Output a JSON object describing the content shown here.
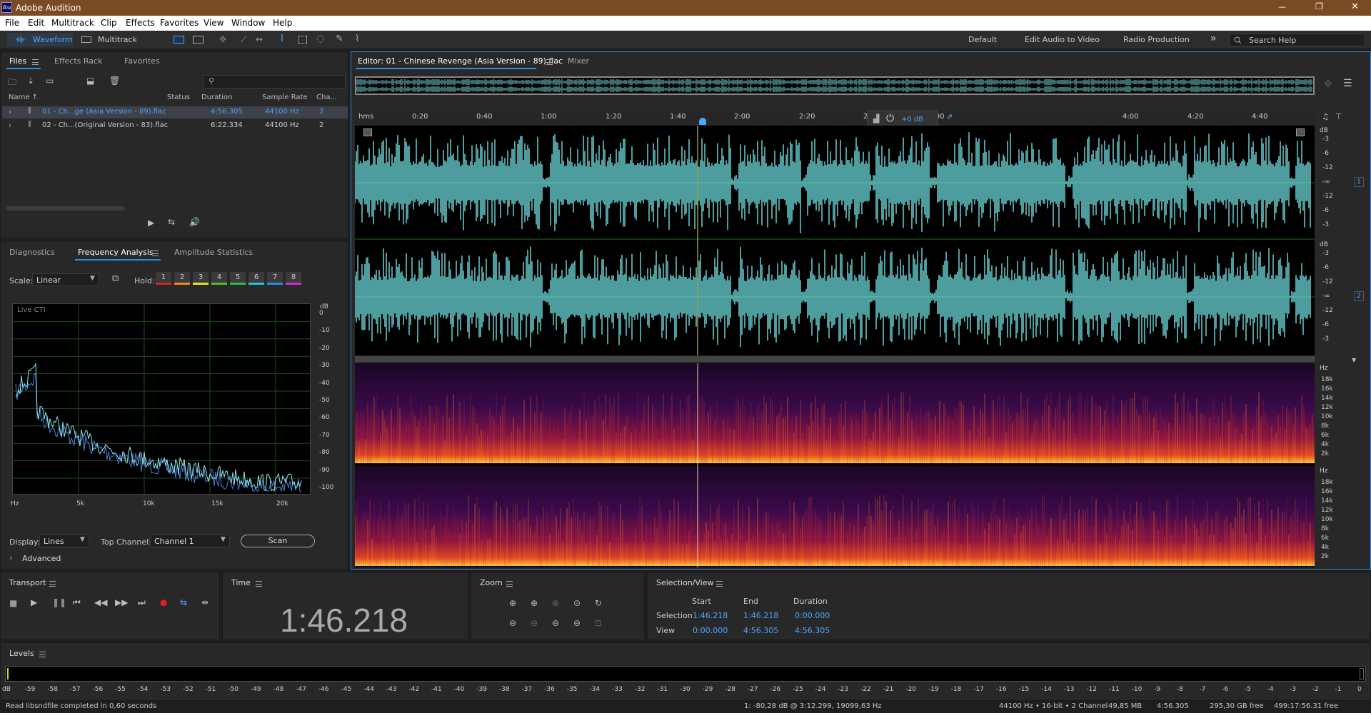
{
  "app": {
    "icon": "Au",
    "title": "Adobe Audition"
  },
  "window_controls": [
    "—",
    "❐",
    "✕"
  ],
  "menu": [
    "File",
    "Edit",
    "Multitrack",
    "Clip",
    "Effects",
    "Favorites",
    "View",
    "Window",
    "Help"
  ],
  "toolbar": {
    "waveform_label": "Waveform",
    "multitrack_label": "Multitrack",
    "workspaces": [
      "Default",
      "Edit Audio to Video",
      "Radio Production"
    ],
    "more": "»",
    "search_placeholder": "Search Help"
  },
  "files_panel": {
    "tabs": [
      "Files",
      "Effects Rack",
      "Favorites"
    ],
    "columns": [
      "Name ↑",
      "Status",
      "Duration",
      "Sample Rate",
      "Cha..."
    ],
    "rows": [
      {
        "name": "01 - Ch...ge (Asia Version - 89).flac",
        "status": "",
        "duration": "4:56.305",
        "rate": "44100 Hz",
        "ch": "2"
      },
      {
        "name": "02 - Ch...(Original Version - 83).flac",
        "status": "",
        "duration": "6:22.334",
        "rate": "44100 Hz",
        "ch": "2"
      }
    ]
  },
  "analysis_panel": {
    "tabs": [
      "Diagnostics",
      "Frequency Analysis",
      "Amplitude Statistics"
    ],
    "scale_label": "Scale:",
    "scale_value": "Linear",
    "hold_label": "Hold:",
    "hold_buttons": [
      "1",
      "2",
      "3",
      "4",
      "5",
      "6",
      "7",
      "8"
    ],
    "hold_colors": [
      "#d0262a",
      "#f08a1a",
      "#e8e21c",
      "#5ab82e",
      "#2fb84a",
      "#1ec8d8",
      "#2a8ae0",
      "#d12ad8"
    ],
    "live_cti": "Live CTI",
    "db_unit": "dB",
    "db_ticks": [
      "0",
      "-10",
      "-20",
      "-30",
      "-40",
      "-50",
      "-60",
      "-70",
      "-80",
      "-90",
      "-100"
    ],
    "x_ticks": [
      "Hz",
      "5k",
      "10k",
      "15k",
      "20k"
    ],
    "display_label": "Display:",
    "display_value": "Lines",
    "top_channel_label": "Top Channel:",
    "top_channel_value": "Channel 1",
    "scan_label": "Scan",
    "advanced_label": "Advanced"
  },
  "editor": {
    "tab_title": "Editor: 01 - Chinese Revenge (Asia Version - 89).flac",
    "mixer_tab": "Mixer",
    "ruler_unit": "hms",
    "ruler": [
      "0:20",
      "0:40",
      "1:00",
      "1:20",
      "1:40",
      "2:00",
      "2:20",
      "2:40",
      "3:00",
      "4:00",
      "4:20",
      "4:40"
    ],
    "gain": "+0 dB",
    "db_unit": "dB",
    "db_scale": [
      "-3",
      "-6",
      "-12",
      "-∞",
      "-12",
      "-6",
      "-3"
    ],
    "channel_badges": [
      "1",
      "2"
    ],
    "hz_unit": "Hz",
    "hz_scale": [
      "18k",
      "16k",
      "14k",
      "12k",
      "10k",
      "8k",
      "6k",
      "4k",
      "2k"
    ],
    "waveform_color": "#6fe0e2"
  },
  "transport": {
    "title": "Transport"
  },
  "time": {
    "title": "Time",
    "value": "1:46.218"
  },
  "zoom": {
    "title": "Zoom"
  },
  "selection": {
    "title": "Selection/View",
    "headers": [
      "Start",
      "End",
      "Duration"
    ],
    "selection_label": "Selection",
    "view_label": "View",
    "selection": [
      "1:46.218",
      "1:46.218",
      "0:00.000"
    ],
    "view": [
      "0:00.000",
      "4:56.305",
      "4:56.305"
    ]
  },
  "levels": {
    "title": "Levels",
    "scale": [
      "dB",
      "-59",
      "-58",
      "-57",
      "-56",
      "-55",
      "-54",
      "-53",
      "-52",
      "-51",
      "-50",
      "-49",
      "-48",
      "-47",
      "-46",
      "-45",
      "-44",
      "-43",
      "-42",
      "-41",
      "-40",
      "-39",
      "-38",
      "-37",
      "-36",
      "-35",
      "-34",
      "-33",
      "-32",
      "-31",
      "-30",
      "-29",
      "-28",
      "-27",
      "-26",
      "-25",
      "-24",
      "-23",
      "-22",
      "-21",
      "-20",
      "-19",
      "-18",
      "-17",
      "-16",
      "-15",
      "-14",
      "-13",
      "-12",
      "-11",
      "-10",
      "-9",
      "-8",
      "-7",
      "-6",
      "-5",
      "-4",
      "-3",
      "-2",
      "-1",
      "0"
    ]
  },
  "status": {
    "message": "Read libsndfile completed in 0,60 seconds",
    "cursor": "1: -80,28 dB @ 3:12.299, 19099,63 Hz",
    "format": "44100 Hz • 16-bit • 2 Channel",
    "size": "49,85 MB",
    "duration": "4:56.305",
    "free": "295,30 GB free",
    "free_time": "499:17:56.31 free"
  }
}
